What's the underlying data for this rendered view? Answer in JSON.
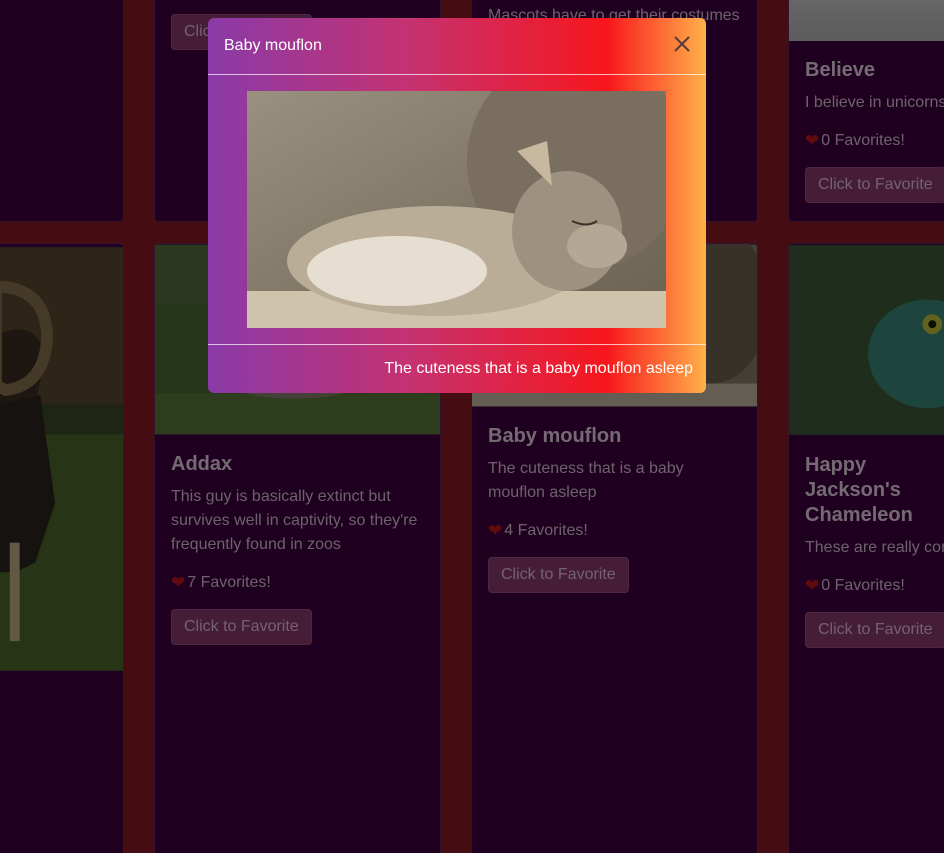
{
  "page": {
    "background": "#8b1a24",
    "card_bg": "#400040"
  },
  "cards": {
    "top_mid": {
      "button": "Click to Favorite"
    },
    "top_mid2": {
      "text": "Mascots have to get their costumes"
    },
    "believe": {
      "title": "Believe",
      "text": "I believe in unicorns",
      "favorites": "0 Favorites!",
      "button": "Click to Favorite"
    },
    "addax": {
      "title": "Addax",
      "text": "This guy is basically extinct but survives well in captivity, so they're frequently found in zoos",
      "favorites": "7 Favorites!",
      "button": "Click to Favorite"
    },
    "mouflon": {
      "title": "Baby mouflon",
      "text": "The cuteness that is a baby mouflon asleep",
      "favorites": "4 Favorites!",
      "button": "Click to Favorite"
    },
    "chameleon": {
      "title": "Happy Jackson's Chameleon",
      "text": "These are really common",
      "favorites": "0 Favorites!",
      "button": "Click to Favorite"
    }
  },
  "modal": {
    "title": "Baby mouflon",
    "caption": "The cuteness that is a baby mouflon asleep",
    "icons": {
      "close": "close-icon",
      "heart": "heart-icon"
    }
  }
}
